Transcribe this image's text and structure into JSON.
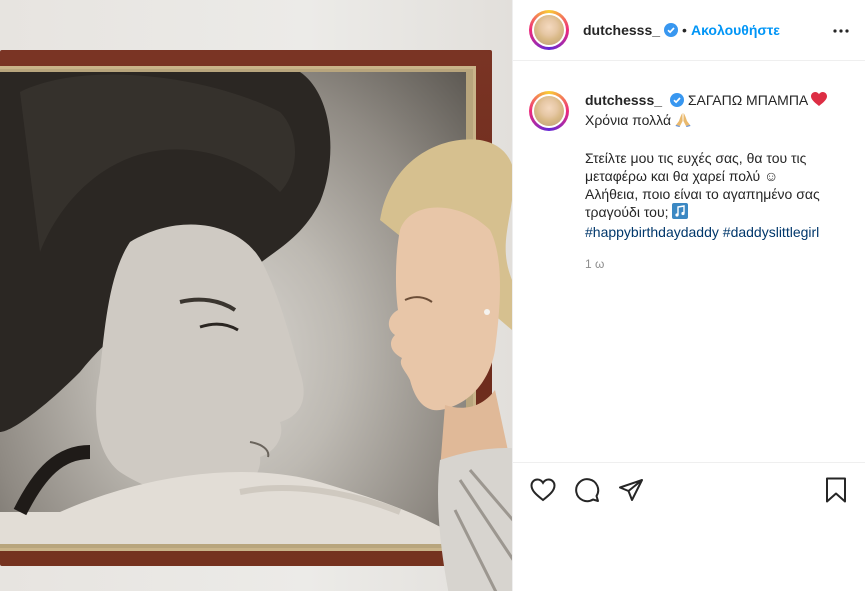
{
  "post": {
    "username": "dutchesss_",
    "follow_label": "Ακολουθήστε",
    "separator": "•",
    "caption_line1": "ΣΑΓΑΠΩ ΜΠΑΜΠΑ",
    "caption_emoji_heart": "❤️",
    "caption_line2": "Χρόνια πολλά",
    "caption_emoji_pray": "🙏",
    "caption_body_1": "Στείλτε μου τις ευχές σας, θα του τις μεταφέρω και θα χαρεί πολύ ☺",
    "caption_body_2": "Αλήθεια, ποιο είναι το αγαπημένο σας τραγούδι του;",
    "caption_emoji_music": "🎼",
    "hashtag_1": "#happybirthdaydaddy",
    "hashtag_2": "#daddyslittlegirl",
    "time": "1 ω"
  },
  "icons": {
    "verified": "verified-badge-icon",
    "more": "more-options-icon",
    "like": "heart-icon",
    "comment": "comment-icon",
    "share": "share-icon",
    "save": "bookmark-icon"
  },
  "colors": {
    "accent": "#0095f6",
    "hashtag": "#00376b",
    "heart": "#ed4956"
  }
}
